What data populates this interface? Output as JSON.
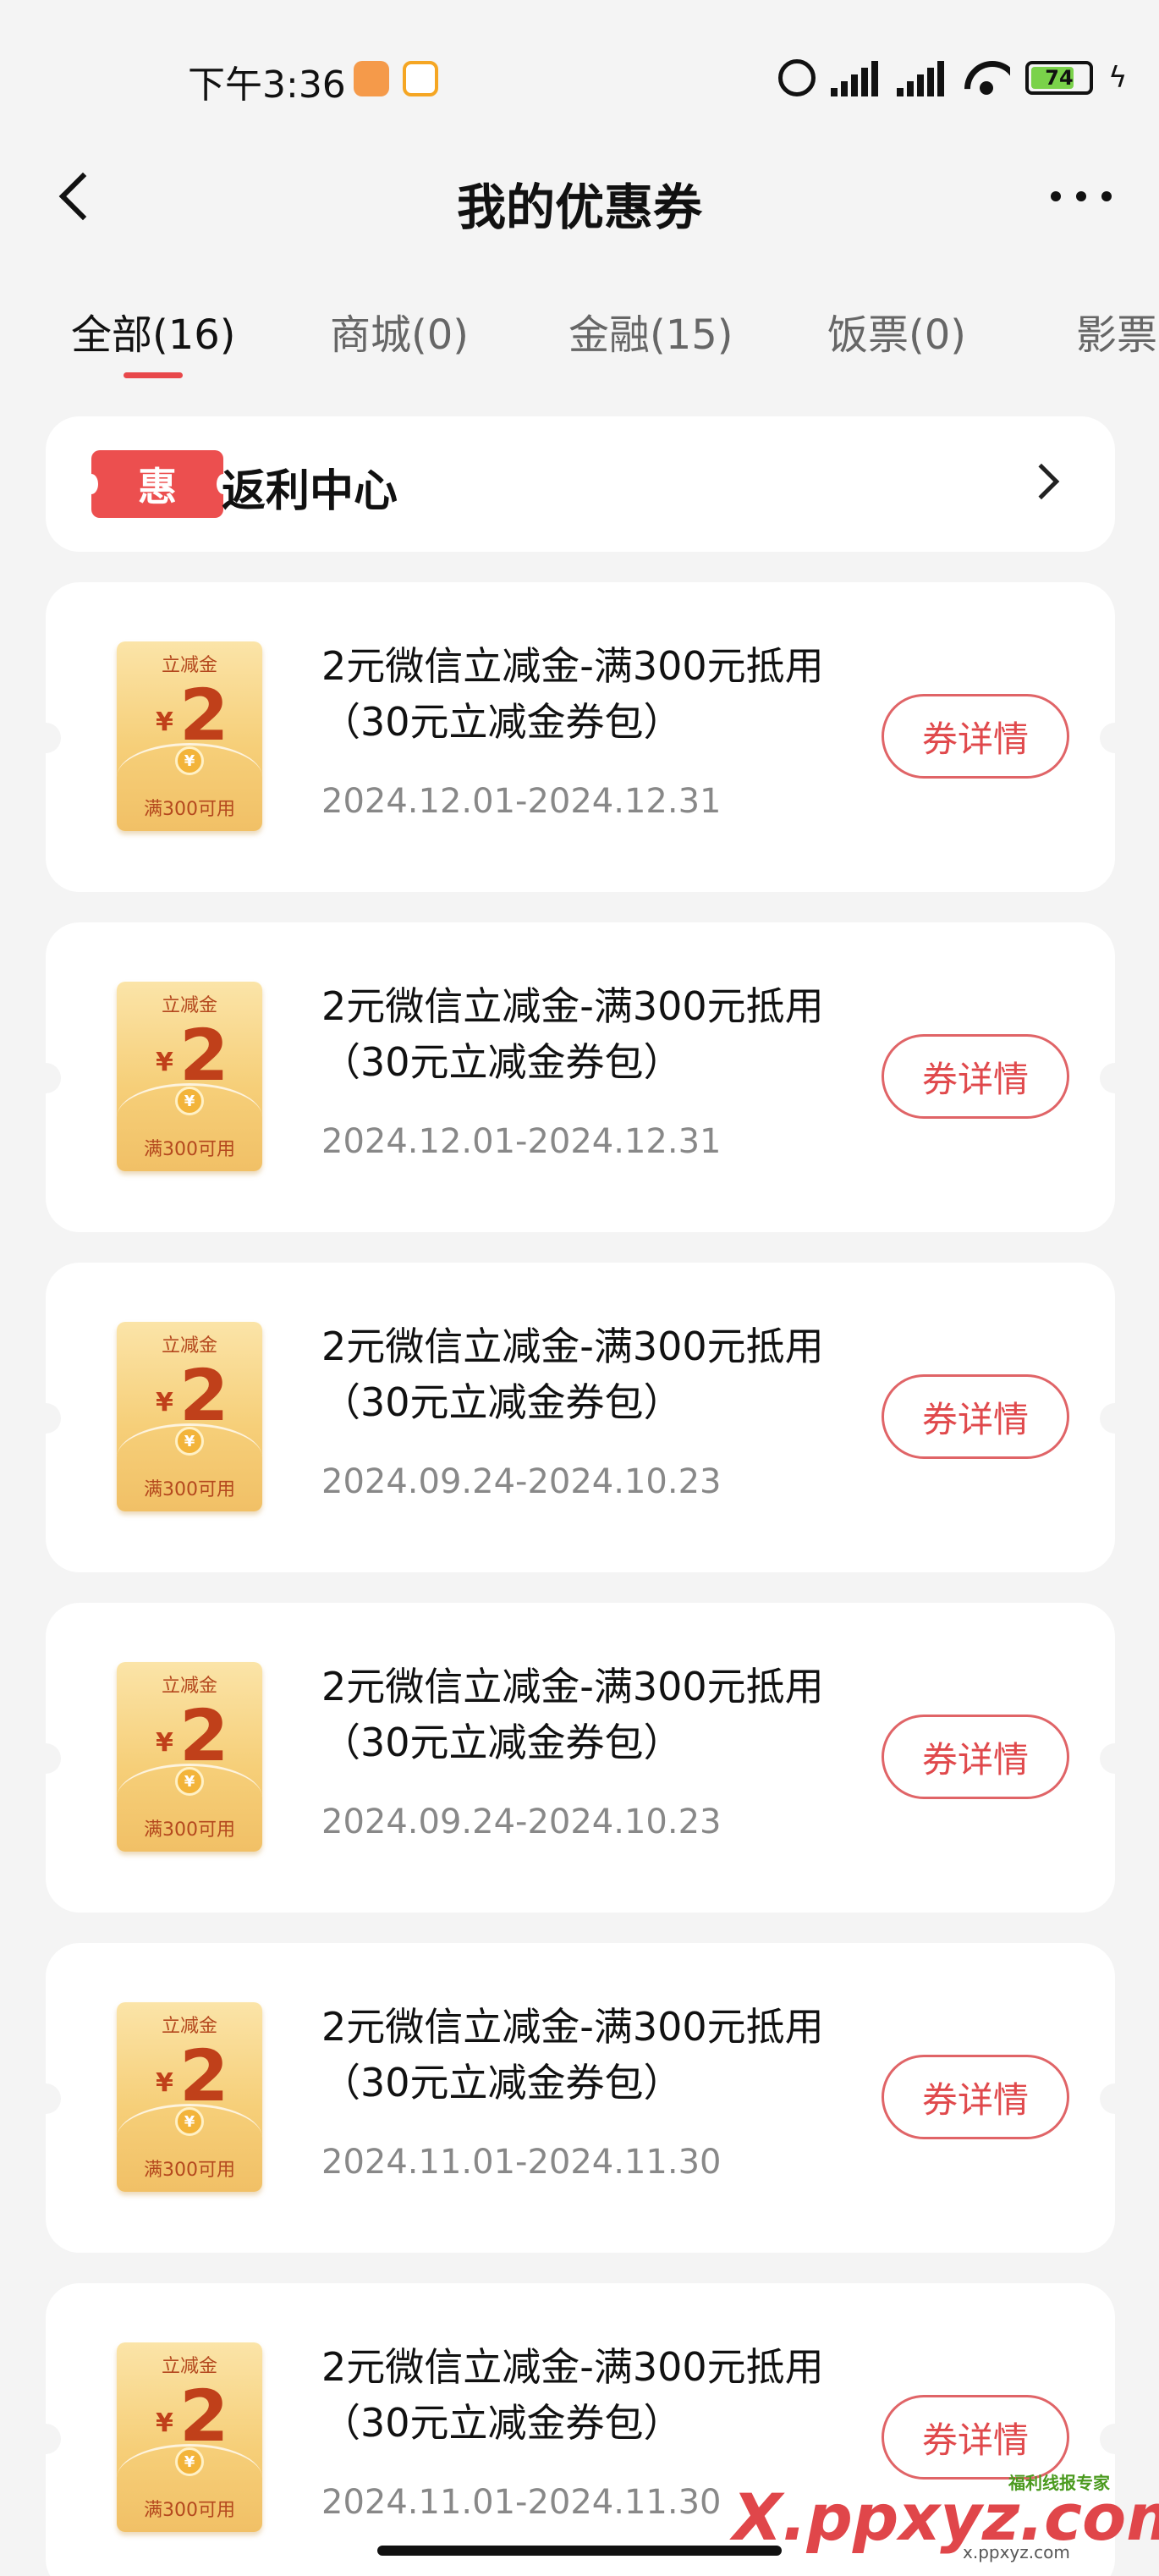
{
  "status_bar": {
    "time": "下午3:36",
    "battery": "74"
  },
  "header": {
    "title": "我的优惠券"
  },
  "tabs": [
    {
      "label": "全部(16)",
      "active": true
    },
    {
      "label": "商城(0)",
      "active": false
    },
    {
      "label": "金融(15)",
      "active": false
    },
    {
      "label": "饭票(0)",
      "active": false
    },
    {
      "label": "影票",
      "active": false
    }
  ],
  "rebate": {
    "badge": "惠",
    "title": "返利中心"
  },
  "coupon_icon": {
    "label": "立减金",
    "currency": "¥",
    "amount": "2",
    "coin": "¥",
    "condition": "满300可用"
  },
  "coupons": [
    {
      "title": "2元微信立减金-满300元抵用（30元立减金券包）",
      "date": "2024.12.01-2024.12.31",
      "button": "券详情"
    },
    {
      "title": "2元微信立减金-满300元抵用（30元立减金券包）",
      "date": "2024.12.01-2024.12.31",
      "button": "券详情"
    },
    {
      "title": "2元微信立减金-满300元抵用（30元立减金券包）",
      "date": "2024.09.24-2024.10.23",
      "button": "券详情"
    },
    {
      "title": "2元微信立减金-满300元抵用（30元立减金券包）",
      "date": "2024.09.24-2024.10.23",
      "button": "券详情"
    },
    {
      "title": "2元微信立减金-满300元抵用（30元立减金券包）",
      "date": "2024.11.01-2024.11.30",
      "button": "券详情"
    },
    {
      "title": "2元微信立减金-满300元抵用（30元立减金券包）",
      "date": "2024.11.01-2024.11.30",
      "button": "券详情"
    }
  ],
  "watermark": {
    "logo": "X.ppxyz.com",
    "badge": "福利线报专家",
    "small": "x.ppxyz.com"
  }
}
